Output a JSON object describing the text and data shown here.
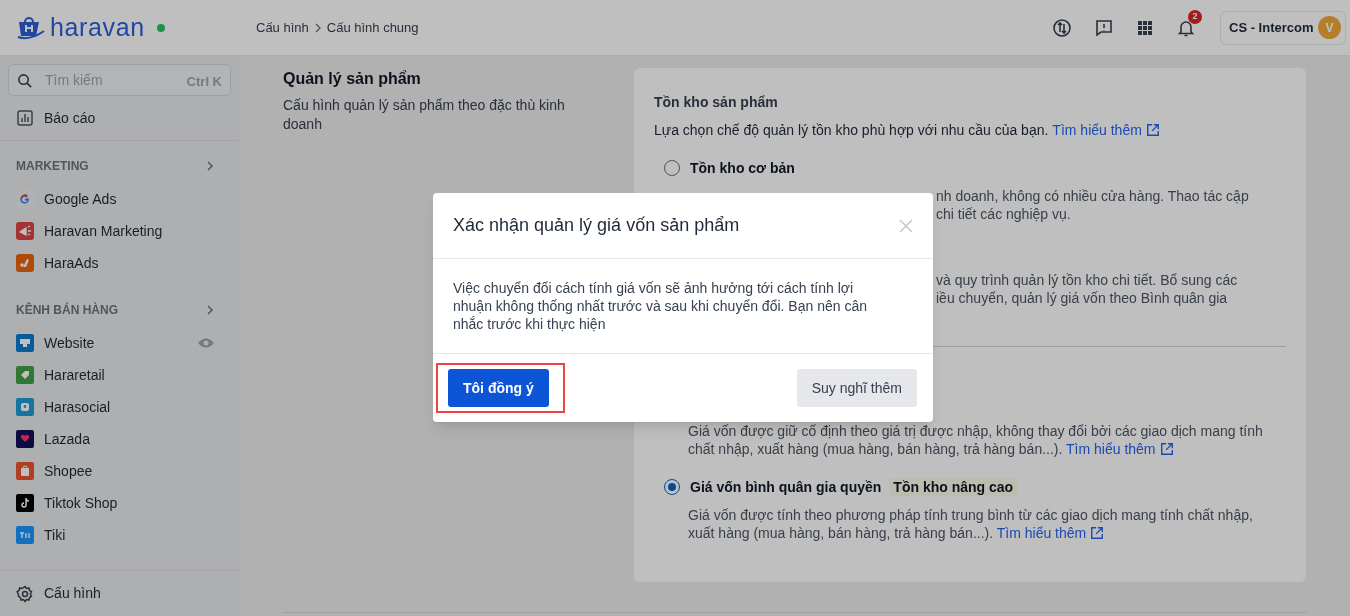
{
  "header": {
    "logo": "haravan",
    "online": true,
    "breadcrumb": [
      "Cấu hình",
      "Cấu hình chung"
    ],
    "notification_count": "2",
    "account": {
      "name": "CS - Intercom",
      "initial": "V"
    }
  },
  "sidebar": {
    "search": {
      "placeholder": "Tìm kiếm",
      "shortcut": "Ctrl K"
    },
    "top_items": [
      {
        "label": "Báo cáo"
      }
    ],
    "groups": [
      {
        "title": "MARKETING",
        "items": [
          {
            "label": "Google Ads"
          },
          {
            "label": "Haravan Marketing"
          },
          {
            "label": "HaraAds"
          }
        ]
      },
      {
        "title": "KÊNH BÁN HÀNG",
        "items": [
          {
            "label": "Website"
          },
          {
            "label": "Hararetail"
          },
          {
            "label": "Harasocial"
          },
          {
            "label": "Lazada"
          },
          {
            "label": "Shopee"
          },
          {
            "label": "Tiktok Shop"
          },
          {
            "label": "Tiki"
          }
        ]
      }
    ],
    "footer_item": {
      "label": "Cấu hình"
    }
  },
  "section": {
    "title": "Quản lý sản phẩm",
    "description": "Cấu hình quản lý sản phẩm theo đặc thù kinh doanh"
  },
  "card": {
    "title": "Tồn kho sản phẩm",
    "description": "Lựa chọn chế độ quản lý tồn kho phù hợp với nhu cầu của bạn.",
    "link": "Tìm hiểu thêm",
    "blocks": [
      {
        "kind": "radio",
        "label": "Tồn kho cơ bản",
        "selected": false
      },
      {
        "kind": "partial",
        "lines": [
          "nh doanh, không có nhiều cửa hàng. Thao tác cập",
          "chi tiết các nghiệp vụ."
        ]
      },
      {
        "kind": "partial",
        "lines": [
          "và quy trình quản lý tồn kho chi tiết. Bổ sung các",
          "iều chuyển, quản lý giá vốn theo Bình quân gia"
        ]
      },
      {
        "kind": "divider"
      },
      {
        "kind": "text",
        "text": "Giá vốn được giữ cố định theo giá trị được nhập, không thay đổi bởi các giao dịch mang tính chất nhập, xuất hàng (mua hàng, bán hàng, trả hàng bán...).",
        "link": "Tìm hiểu thêm"
      },
      {
        "kind": "radio",
        "label": "Giá vốn bình quân gia quyền",
        "tag": "Tồn kho nâng cao",
        "selected": true
      },
      {
        "kind": "text",
        "text": "Giá vốn được tính theo phương pháp tính trung bình từ các giao dịch mang tính chất nhập, xuất hàng (mua hàng, bán hàng, trả hàng bán...).",
        "link": "Tìm hiểu thêm"
      }
    ]
  },
  "modal": {
    "title": "Xác nhận quản lý giá vốn sản phẩm",
    "body": "Việc chuyển đổi cách tính giá vốn sẽ ảnh hưởng tới cách tính lợi nhuận không thống nhất trước và sau khi chuyển đổi. Bạn nên cân nhắc trước khi thực hiện",
    "confirm": {
      "label": "Tôi đồng ý",
      "highlighted": true
    },
    "cancel": {
      "label": "Suy nghĩ thêm"
    }
  }
}
